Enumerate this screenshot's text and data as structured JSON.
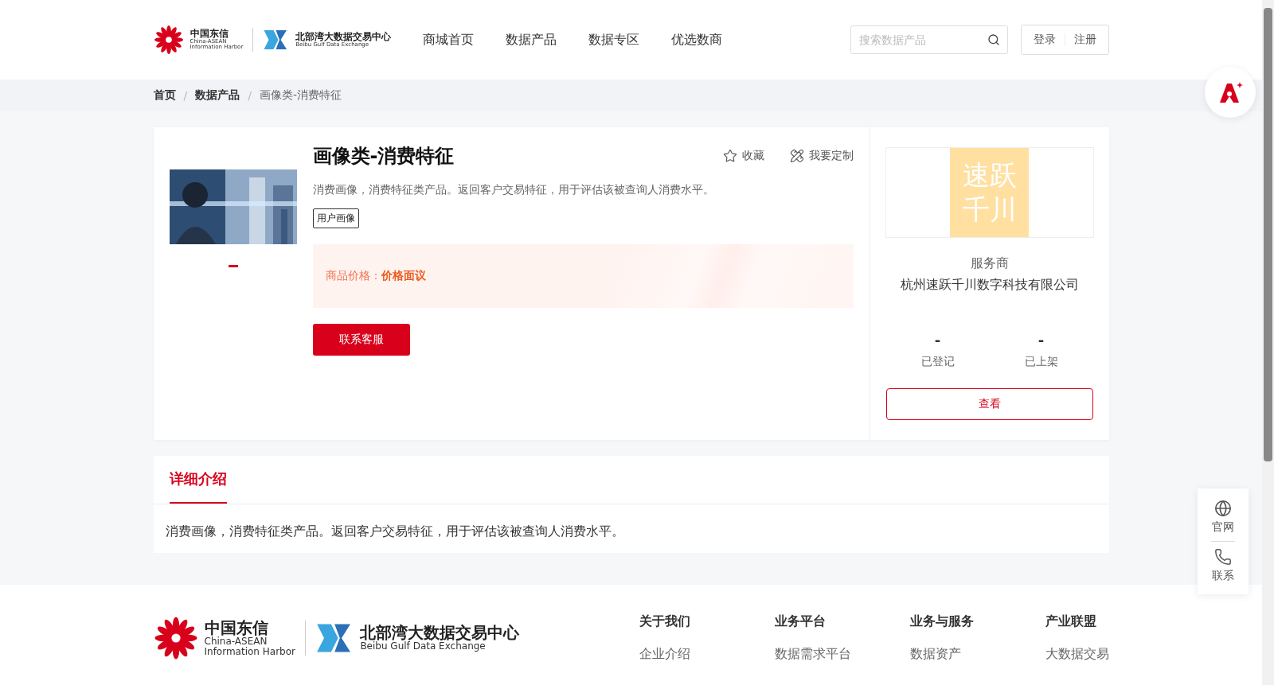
{
  "header": {
    "logo_cn": {
      "name": "中国东信",
      "sub1": "China-ASEAN",
      "sub2": "Information Harbor"
    },
    "logo_bb": {
      "name": "北部湾大数据交易中心",
      "sub": "Beibu Gulf Data Exchange"
    },
    "nav": [
      {
        "label": "商城首页",
        "selected": false
      },
      {
        "label": "数据产品",
        "selected": false
      },
      {
        "label": "数据专区",
        "selected": false
      },
      {
        "label": "优选数商",
        "selected": false
      }
    ],
    "search": {
      "placeholder": "搜索数据产品"
    },
    "auth": [
      "登录",
      "注册"
    ]
  },
  "breadcrumb": {
    "items": [
      "首页",
      "数据产品",
      "画像类-消费特征"
    ],
    "separators": [
      "/",
      "/"
    ]
  },
  "product": {
    "title": "画像类-消费特征",
    "actions": [
      {
        "kind": "favorite",
        "label": "收藏"
      },
      {
        "kind": "custom",
        "label": "我要定制"
      }
    ],
    "description": "消费画像，消费特征类产品。返回客户交易特征，用于评估该被查询人消费水平。",
    "tag": "用户画像",
    "price_label": "商品价格：",
    "price_value": "价格面议",
    "contact_button": "联系客服",
    "carousel_dots": [
      {
        "selected": true
      }
    ]
  },
  "provider": {
    "logo_lines": [
      "速跃",
      "千川"
    ],
    "role": "服务商",
    "name": "杭州速跃千川数字科技有限公司",
    "stats": [
      {
        "value": "-",
        "label": "已登记"
      },
      {
        "value": "-",
        "label": "已上架"
      }
    ],
    "view_button": "查看"
  },
  "detail": {
    "tabs": [
      {
        "label": "详细介绍",
        "selected": true
      }
    ],
    "text": "消费画像，消费特征类产品。返回客户交易特征，用于评估该被查询人消费水平。"
  },
  "side_float": [
    {
      "kind": "globe",
      "label": "官网"
    },
    {
      "kind": "phone",
      "label": "联系"
    }
  ],
  "footer": {
    "logo_cn": {
      "name": "中国东信",
      "sub1": "China-ASEAN",
      "sub2": "Information Harbor"
    },
    "logo_bb": {
      "name": "北部湾大数据交易中心",
      "sub": "Beibu Gulf Data Exchange"
    },
    "columns": [
      {
        "title": "关于我们",
        "links": [
          "企业介绍"
        ]
      },
      {
        "title": "业务平台",
        "links": [
          "数据需求平台"
        ]
      },
      {
        "title": "业务与服务",
        "links": [
          "数据资产"
        ]
      },
      {
        "title": "产业联盟",
        "links": [
          "大数据交易"
        ]
      }
    ]
  }
}
